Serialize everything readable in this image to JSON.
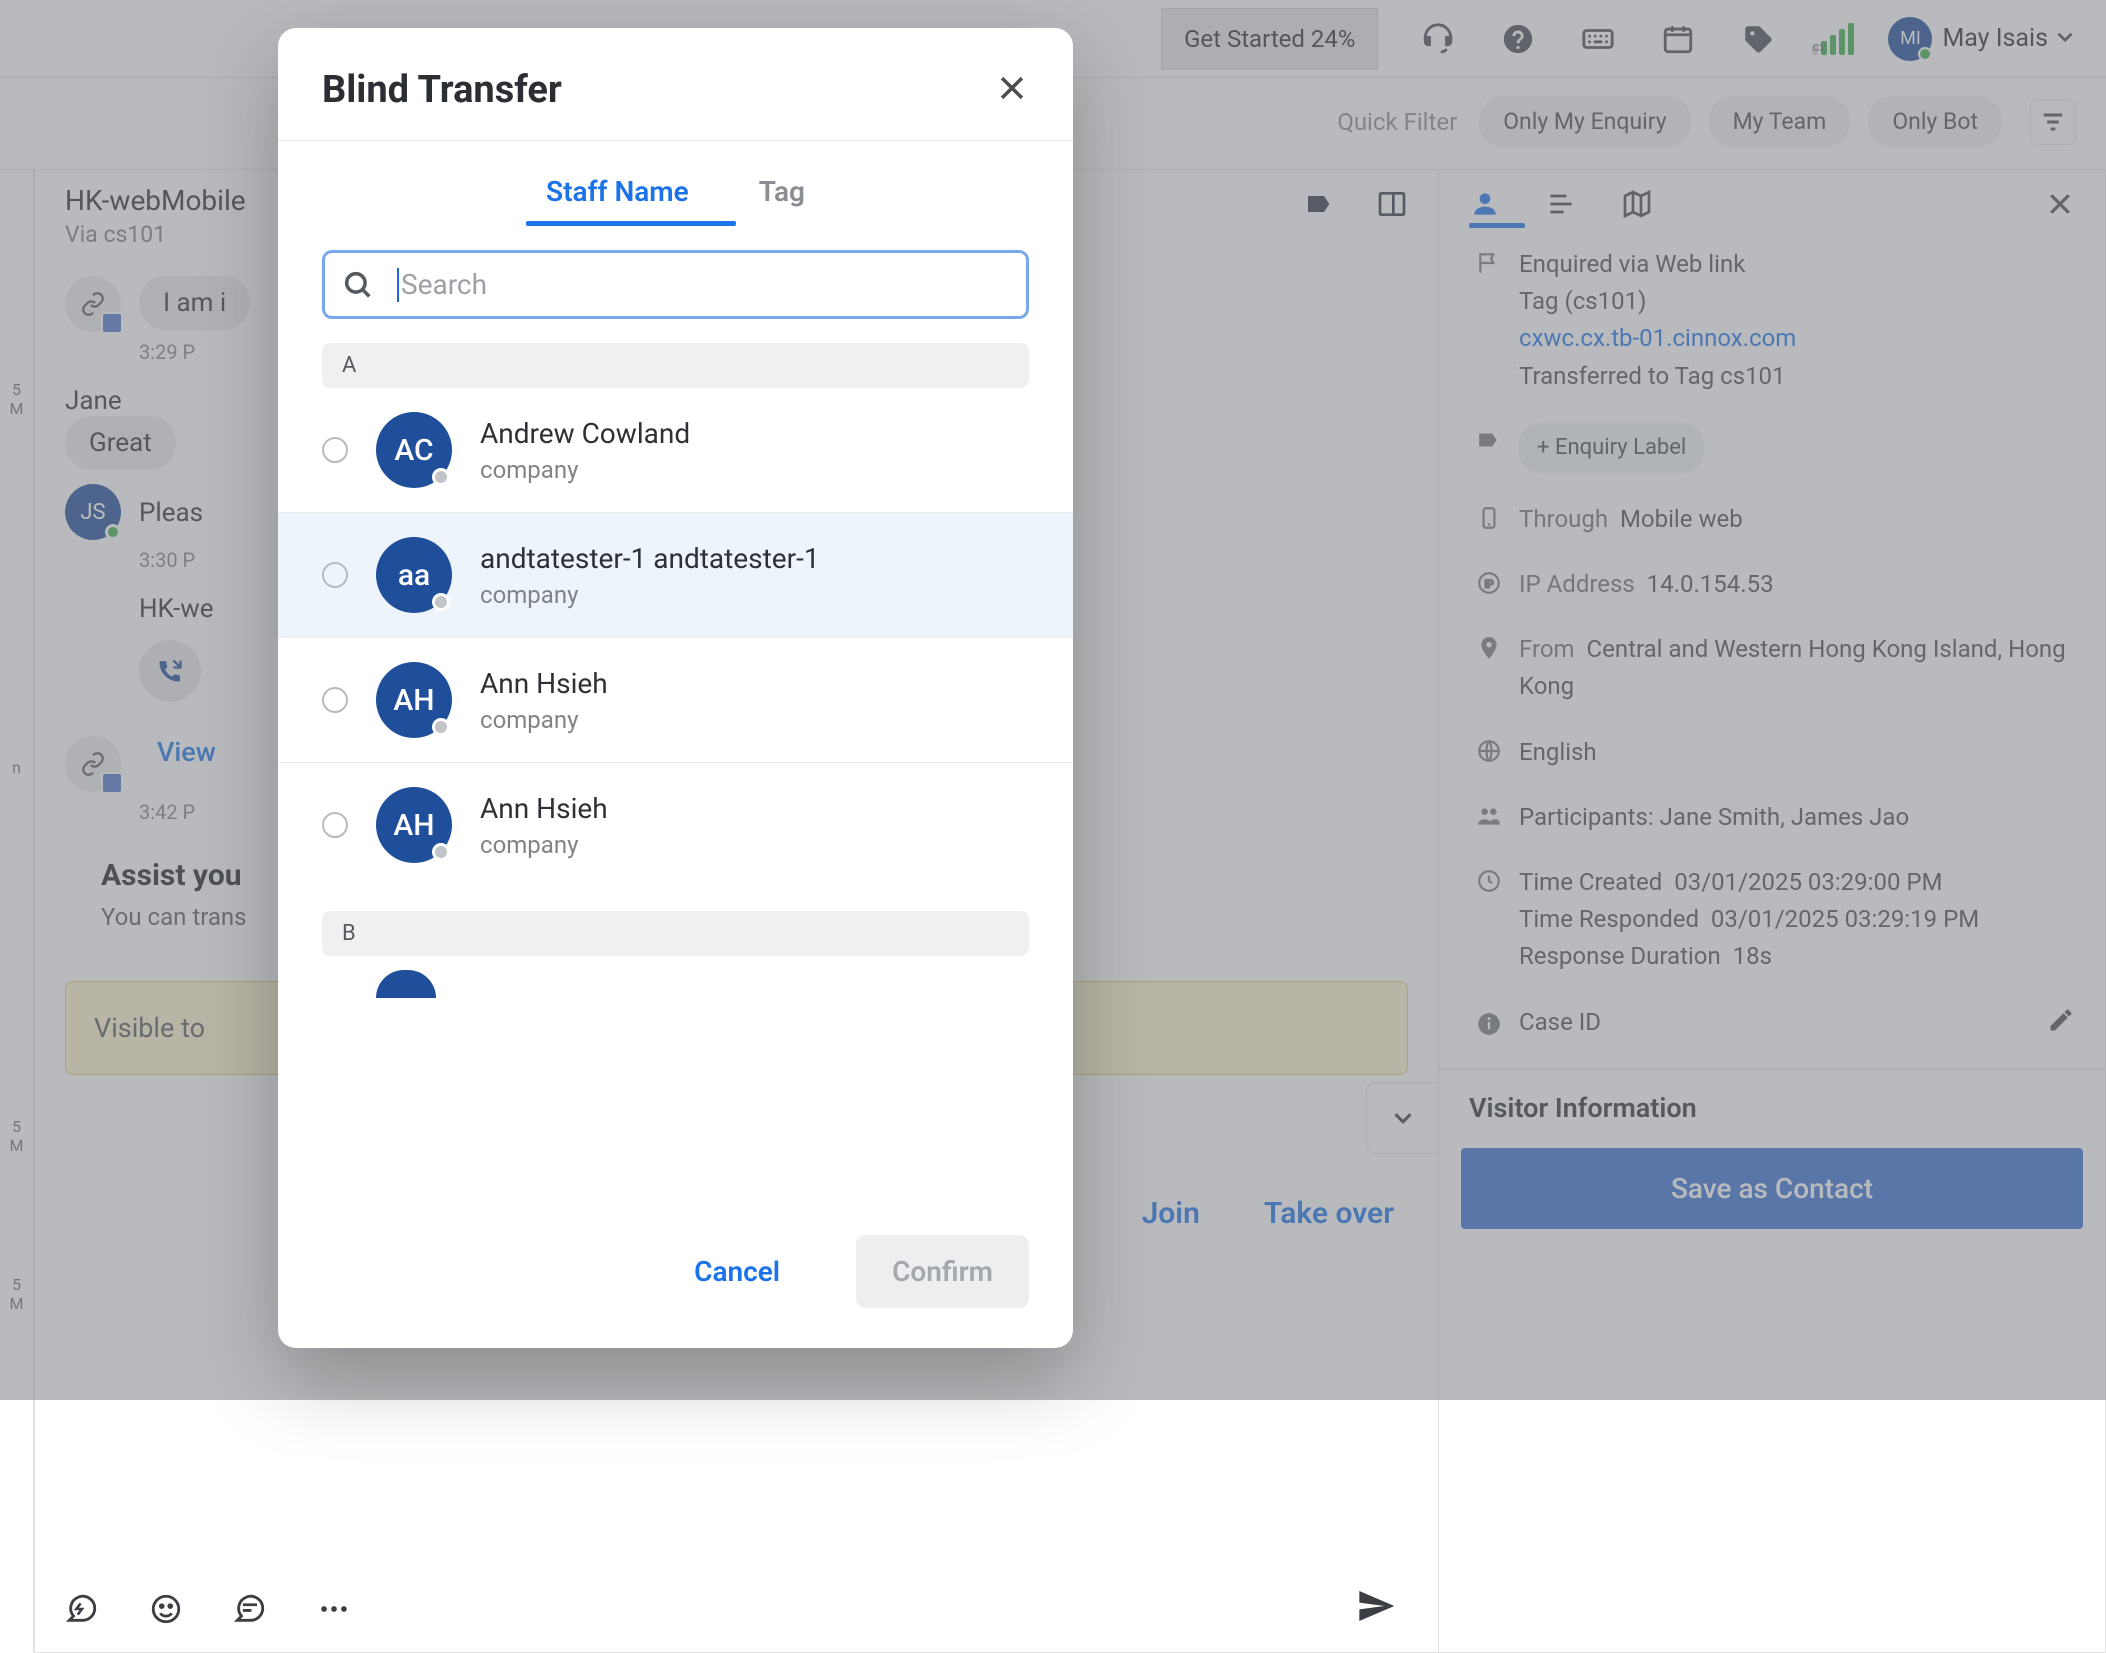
{
  "header": {
    "getStarted": "Get Started 24%",
    "cxLabel": "cx",
    "userInitials": "MI",
    "userName": "May Isais"
  },
  "quickFilter": {
    "label": "Quick Filter",
    "pills": [
      "Only My Enquiry",
      "My Team",
      "Only Bot"
    ]
  },
  "chat": {
    "title": "HK-webMobile",
    "via": "Via cs101",
    "rows": [
      {
        "avatar": "link",
        "text": "I am i",
        "time": "3:29 P"
      },
      {
        "plain": "Jane"
      },
      {
        "bubble": "Great"
      },
      {
        "avatar": "js",
        "text": "Pleas",
        "time": "3:30 P"
      },
      {
        "plain": "HK-we"
      },
      {
        "call": true
      },
      {
        "avatar": "link",
        "view": "View",
        "time": "3:42 P"
      }
    ],
    "assistTitle": "Assist you",
    "assistText": "You can trans",
    "join": "Join",
    "takeover": "Take over",
    "yellow": "Visible to"
  },
  "side": {
    "line1": "Enquired via Web link",
    "line2": "Tag (cs101)",
    "link": "cxwc.cx.tb-01.cinnox.com",
    "line3": "Transferred to Tag cs101",
    "enquiryLabel": "+ Enquiry Label",
    "through": "Through",
    "throughVal": "Mobile web",
    "ipK": "IP Address",
    "ipV": "14.0.154.53",
    "fromK": "From",
    "fromV": "Central and Western Hong Kong Island, Hong Kong",
    "lang": "English",
    "participants": "Participants: Jane Smith, James Jao",
    "timeCreatedK": "Time Created",
    "timeCreatedV": "03/01/2025 03:29:00 PM",
    "timeRespK": "Time Responded",
    "timeRespV": "03/01/2025 03:29:19 PM",
    "respDurK": "Response Duration",
    "respDurV": "18s",
    "caseId": "Case ID",
    "visitorHeading": "Visitor Information",
    "save": "Save as Contact"
  },
  "gutter": {
    "a": "5\nM",
    "b": "n",
    "c": "5\nM",
    "d": "5\nM"
  },
  "modal": {
    "title": "Blind Transfer",
    "tabs": {
      "staff": "Staff Name",
      "tag": "Tag"
    },
    "searchPlaceholder": "Search",
    "sections": [
      {
        "letter": "A",
        "items": [
          {
            "initials": "AC",
            "name": "Andrew Cowland",
            "company": "company"
          },
          {
            "initials": "aa",
            "name": "andtatester-1 andtatester-1",
            "company": "company",
            "hl": true
          },
          {
            "initials": "AH",
            "name": "Ann Hsieh",
            "company": "company"
          },
          {
            "initials": "AH",
            "name": "Ann Hsieh",
            "company": "company"
          }
        ]
      },
      {
        "letter": "B",
        "items": []
      }
    ],
    "cancel": "Cancel",
    "confirm": "Confirm"
  },
  "chart_data": null
}
